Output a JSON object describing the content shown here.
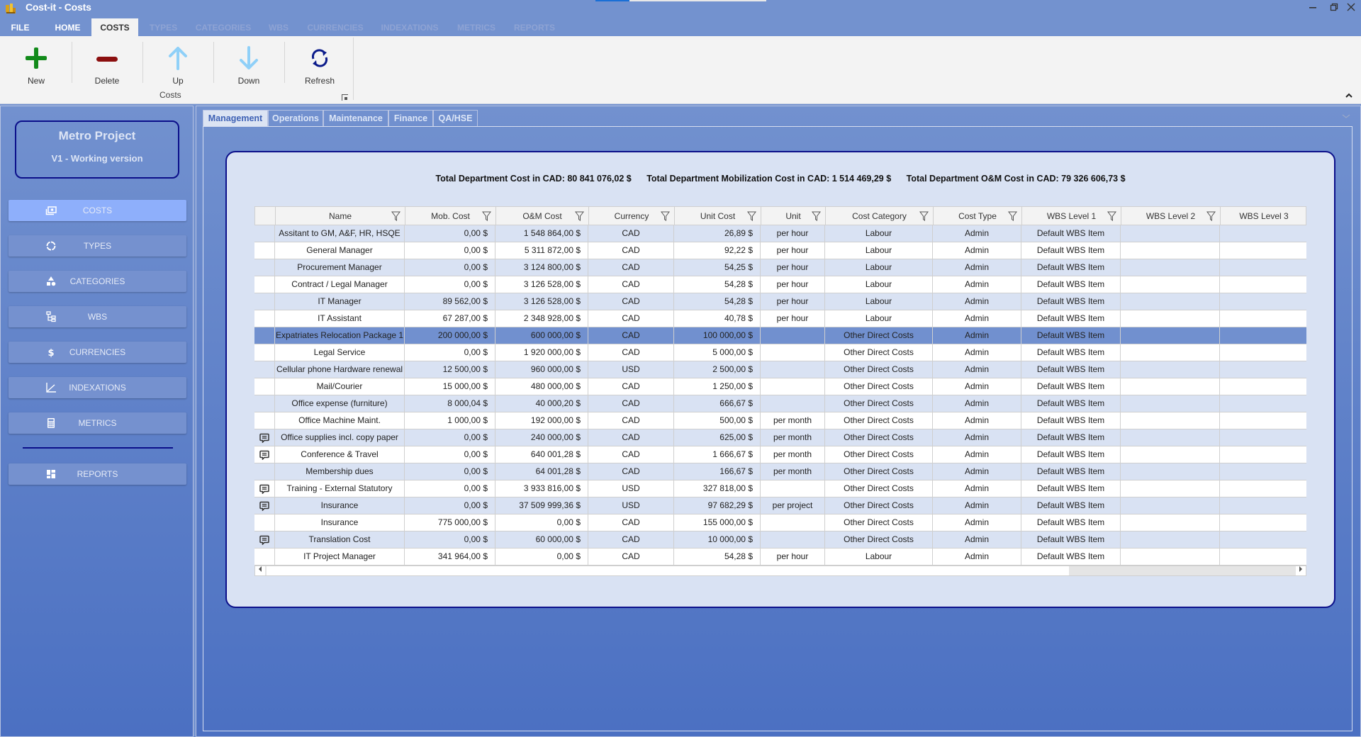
{
  "window": {
    "title": "Cost-it - Costs",
    "minimize_icon": "minimize-icon",
    "restore_icon": "restore-icon",
    "close_icon": "close-icon"
  },
  "ribbon_tabs": [
    {
      "label": "FILE",
      "state": "enabled"
    },
    {
      "label": "HOME",
      "state": "enabled"
    },
    {
      "label": "COSTS",
      "state": "active"
    },
    {
      "label": "TYPES",
      "state": "disabled"
    },
    {
      "label": "CATEGORIES",
      "state": "disabled"
    },
    {
      "label": "WBS",
      "state": "disabled"
    },
    {
      "label": "CURRENCIES",
      "state": "disabled"
    },
    {
      "label": "INDEXATIONS",
      "state": "disabled"
    },
    {
      "label": "METRICS",
      "state": "disabled"
    },
    {
      "label": "REPORTS",
      "state": "disabled"
    }
  ],
  "ribbon": {
    "group_label": "Costs",
    "buttons": [
      {
        "label": "New",
        "icon": "plus-icon",
        "color": "#128a1a"
      },
      {
        "label": "Delete",
        "icon": "minus-icon",
        "color": "#8b0f0f"
      },
      {
        "label": "Up",
        "icon": "arrow-up-icon",
        "color": "#8fd0f8"
      },
      {
        "label": "Down",
        "icon": "arrow-down-icon",
        "color": "#8fd0f8"
      },
      {
        "label": "Refresh",
        "icon": "refresh-icon",
        "color": "#0b1b8a"
      }
    ]
  },
  "project": {
    "name": "Metro Project",
    "version": "V1 - Working version"
  },
  "sidebar": {
    "items": [
      {
        "label": "COSTS",
        "icon": "money-icon",
        "active": true
      },
      {
        "label": "TYPES",
        "icon": "ring-icon",
        "active": false
      },
      {
        "label": "CATEGORIES",
        "icon": "shapes-icon",
        "active": false
      },
      {
        "label": "WBS",
        "icon": "hierarchy-icon",
        "active": false
      },
      {
        "label": "CURRENCIES",
        "icon": "dollar-icon",
        "active": false
      },
      {
        "label": "INDEXATIONS",
        "icon": "chart-line-icon",
        "active": false
      },
      {
        "label": "METRICS",
        "icon": "calculator-icon",
        "active": false
      }
    ],
    "reports": {
      "label": "REPORTS",
      "icon": "dashboard-icon"
    }
  },
  "department_tabs": [
    {
      "label": "Management",
      "active": true
    },
    {
      "label": "Operations",
      "active": false
    },
    {
      "label": "Maintenance",
      "active": false
    },
    {
      "label": "Finance",
      "active": false
    },
    {
      "label": "QA/HSE",
      "active": false
    }
  ],
  "totals": {
    "total": "Total Department Cost in CAD: 80 841 076,02 $",
    "mobilization": "Total Department Mobilization Cost in CAD: 1 514 469,29 $",
    "om": "Total Department O&M Cost in CAD: 79 326 606,73 $"
  },
  "grid": {
    "columns": [
      "",
      "Name",
      "Mob. Cost",
      "O&M Cost",
      "Currency",
      "Unit Cost",
      "Unit",
      "Cost Category",
      "Cost Type",
      "WBS Level 1",
      "WBS Level 2",
      "WBS Level 3"
    ],
    "selected_row": 6,
    "rows": [
      {
        "note": false,
        "name": "Assitant to GM, A&F, HR, HSQE",
        "mob": "0,00 $",
        "om": "1 548 864,00 $",
        "currency": "CAD",
        "unit_cost": "26,89 $",
        "unit": "per hour",
        "category": "Labour",
        "type": "Admin",
        "wbs1": "Default WBS Item",
        "wbs2": "",
        "wbs3": ""
      },
      {
        "note": false,
        "name": "General Manager",
        "mob": "0,00 $",
        "om": "5 311 872,00 $",
        "currency": "CAD",
        "unit_cost": "92,22 $",
        "unit": "per hour",
        "category": "Labour",
        "type": "Admin",
        "wbs1": "Default WBS Item",
        "wbs2": "",
        "wbs3": ""
      },
      {
        "note": false,
        "name": "Procurement  Manager",
        "mob": "0,00 $",
        "om": "3 124 800,00 $",
        "currency": "CAD",
        "unit_cost": "54,25 $",
        "unit": "per hour",
        "category": "Labour",
        "type": "Admin",
        "wbs1": "Default WBS Item",
        "wbs2": "",
        "wbs3": ""
      },
      {
        "note": false,
        "name": "Contract / Legal Manager",
        "mob": "0,00 $",
        "om": "3 126 528,00 $",
        "currency": "CAD",
        "unit_cost": "54,28 $",
        "unit": "per hour",
        "category": "Labour",
        "type": "Admin",
        "wbs1": "Default WBS Item",
        "wbs2": "",
        "wbs3": ""
      },
      {
        "note": false,
        "name": "IT Manager",
        "mob": "89 562,00 $",
        "om": "3 126 528,00 $",
        "currency": "CAD",
        "unit_cost": "54,28 $",
        "unit": "per hour",
        "category": "Labour",
        "type": "Admin",
        "wbs1": "Default WBS Item",
        "wbs2": "",
        "wbs3": ""
      },
      {
        "note": false,
        "name": "IT Assistant",
        "mob": "67 287,00 $",
        "om": "2 348 928,00 $",
        "currency": "CAD",
        "unit_cost": "40,78 $",
        "unit": "per hour",
        "category": "Labour",
        "type": "Admin",
        "wbs1": "Default WBS Item",
        "wbs2": "",
        "wbs3": ""
      },
      {
        "note": false,
        "name": "Expatriates Relocation Package 1",
        "mob": "200 000,00 $",
        "om": "600 000,00 $",
        "currency": "CAD",
        "unit_cost": "100 000,00 $",
        "unit": "",
        "category": "Other Direct Costs",
        "type": "Admin",
        "wbs1": "Default WBS Item",
        "wbs2": "",
        "wbs3": ""
      },
      {
        "note": false,
        "name": "Legal Service",
        "mob": "0,00 $",
        "om": "1 920 000,00 $",
        "currency": "CAD",
        "unit_cost": "5 000,00 $",
        "unit": "",
        "category": "Other Direct Costs",
        "type": "Admin",
        "wbs1": "Default WBS Item",
        "wbs2": "",
        "wbs3": ""
      },
      {
        "note": false,
        "name": "Cellular phone Hardware renewal",
        "mob": "12 500,00 $",
        "om": "960 000,00 $",
        "currency": "USD",
        "unit_cost": "2 500,00 $",
        "unit": "",
        "category": "Other Direct Costs",
        "type": "Admin",
        "wbs1": "Default WBS Item",
        "wbs2": "",
        "wbs3": ""
      },
      {
        "note": false,
        "name": "Mail/Courier",
        "mob": "15 000,00 $",
        "om": "480 000,00 $",
        "currency": "CAD",
        "unit_cost": "1 250,00 $",
        "unit": "",
        "category": "Other Direct Costs",
        "type": "Admin",
        "wbs1": "Default WBS Item",
        "wbs2": "",
        "wbs3": ""
      },
      {
        "note": false,
        "name": "Office expense (furniture)",
        "mob": "8 000,04 $",
        "om": "40 000,20 $",
        "currency": "CAD",
        "unit_cost": "666,67 $",
        "unit": "",
        "category": "Other Direct Costs",
        "type": "Admin",
        "wbs1": "Default WBS Item",
        "wbs2": "",
        "wbs3": ""
      },
      {
        "note": false,
        "name": "Office Machine Maint.",
        "mob": "1 000,00 $",
        "om": "192 000,00 $",
        "currency": "CAD",
        "unit_cost": "500,00 $",
        "unit": "per month",
        "category": "Other Direct Costs",
        "type": "Admin",
        "wbs1": "Default WBS Item",
        "wbs2": "",
        "wbs3": ""
      },
      {
        "note": true,
        "name": "Office supplies incl. copy paper",
        "mob": "0,00 $",
        "om": "240 000,00 $",
        "currency": "CAD",
        "unit_cost": "625,00 $",
        "unit": "per month",
        "category": "Other Direct Costs",
        "type": "Admin",
        "wbs1": "Default WBS Item",
        "wbs2": "",
        "wbs3": ""
      },
      {
        "note": true,
        "name": "Conference & Travel",
        "mob": "0,00 $",
        "om": "640 001,28 $",
        "currency": "CAD",
        "unit_cost": "1 666,67 $",
        "unit": "per month",
        "category": "Other Direct Costs",
        "type": "Admin",
        "wbs1": "Default WBS Item",
        "wbs2": "",
        "wbs3": ""
      },
      {
        "note": false,
        "name": "Membership dues",
        "mob": "0,00 $",
        "om": "64 001,28 $",
        "currency": "CAD",
        "unit_cost": "166,67 $",
        "unit": "per month",
        "category": "Other Direct Costs",
        "type": "Admin",
        "wbs1": "Default WBS Item",
        "wbs2": "",
        "wbs3": ""
      },
      {
        "note": true,
        "name": "Training - External Statutory",
        "mob": "0,00 $",
        "om": "3 933 816,00 $",
        "currency": "USD",
        "unit_cost": "327 818,00 $",
        "unit": "",
        "category": "Other Direct Costs",
        "type": "Admin",
        "wbs1": "Default WBS Item",
        "wbs2": "",
        "wbs3": ""
      },
      {
        "note": true,
        "name": "Insurance",
        "mob": "0,00 $",
        "om": "37 509 999,36 $",
        "currency": "USD",
        "unit_cost": "97 682,29 $",
        "unit": "per project",
        "category": "Other Direct Costs",
        "type": "Admin",
        "wbs1": "Default WBS Item",
        "wbs2": "",
        "wbs3": ""
      },
      {
        "note": false,
        "name": "Insurance",
        "mob": "775 000,00 $",
        "om": "0,00 $",
        "currency": "CAD",
        "unit_cost": "155 000,00 $",
        "unit": "",
        "category": "Other Direct Costs",
        "type": "Admin",
        "wbs1": "Default WBS Item",
        "wbs2": "",
        "wbs3": ""
      },
      {
        "note": true,
        "name": "Translation Cost",
        "mob": "0,00 $",
        "om": "60 000,00 $",
        "currency": "CAD",
        "unit_cost": "10 000,00 $",
        "unit": "",
        "category": "Other Direct Costs",
        "type": "Admin",
        "wbs1": "Default WBS Item",
        "wbs2": "",
        "wbs3": ""
      },
      {
        "note": false,
        "name": "IT Project Manager",
        "mob": "341 964,00 $",
        "om": "0,00 $",
        "currency": "CAD",
        "unit_cost": "54,28 $",
        "unit": "per hour",
        "category": "Labour",
        "type": "Admin",
        "wbs1": "Default WBS Item",
        "wbs2": "",
        "wbs3": ""
      }
    ]
  }
}
